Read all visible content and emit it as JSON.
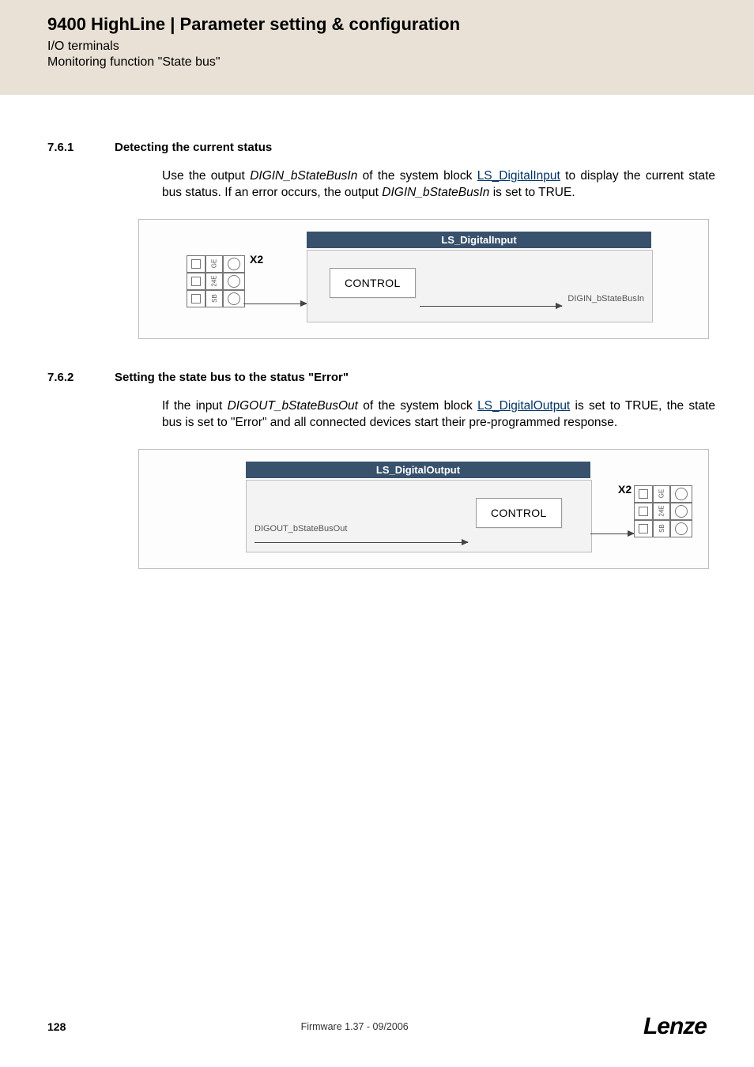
{
  "header": {
    "title": "9400 HighLine | Parameter setting & configuration",
    "sub1": "I/O terminals",
    "sub2": "Monitoring function \"State bus\""
  },
  "sections": {
    "s1": {
      "num": "7.6.1",
      "title": "Detecting the current status",
      "para_before": "Use the output ",
      "var1": "DIGIN_bStateBusIn",
      "mid1": " of the system block ",
      "link1": "LS_DigitalInput",
      "mid2": " to display the current state bus status. If an error occurs, the output ",
      "var2": "DIGIN_bStateBusIn",
      "after": " is set to TRUE."
    },
    "s2": {
      "num": "7.6.2",
      "title": "Setting the state bus to the status \"Error\"",
      "before": "If the input ",
      "var1": "DIGOUT_bStateBusOut",
      "mid1": " of the system block ",
      "link1": "LS_DigitalOutput",
      "after": " is set to TRUE, the state bus is set to \"Error\" and all connected devices start their pre-programmed response."
    }
  },
  "diagram1": {
    "block_title": "LS_DigitalInput",
    "ctrl": "CONTROL",
    "port": "DIGIN_bStateBusIn",
    "x2": "X2",
    "t1": "GE",
    "t2": "24E",
    "t3": "SB"
  },
  "diagram2": {
    "block_title": "LS_DigitalOutput",
    "ctrl": "CONTROL",
    "port": "DIGOUT_bStateBusOut",
    "x2": "X2",
    "t1": "GE",
    "t2": "24E",
    "t3": "SB"
  },
  "footer": {
    "page": "128",
    "fw": "Firmware 1.37 - 09/2006",
    "logo": "Lenze"
  }
}
